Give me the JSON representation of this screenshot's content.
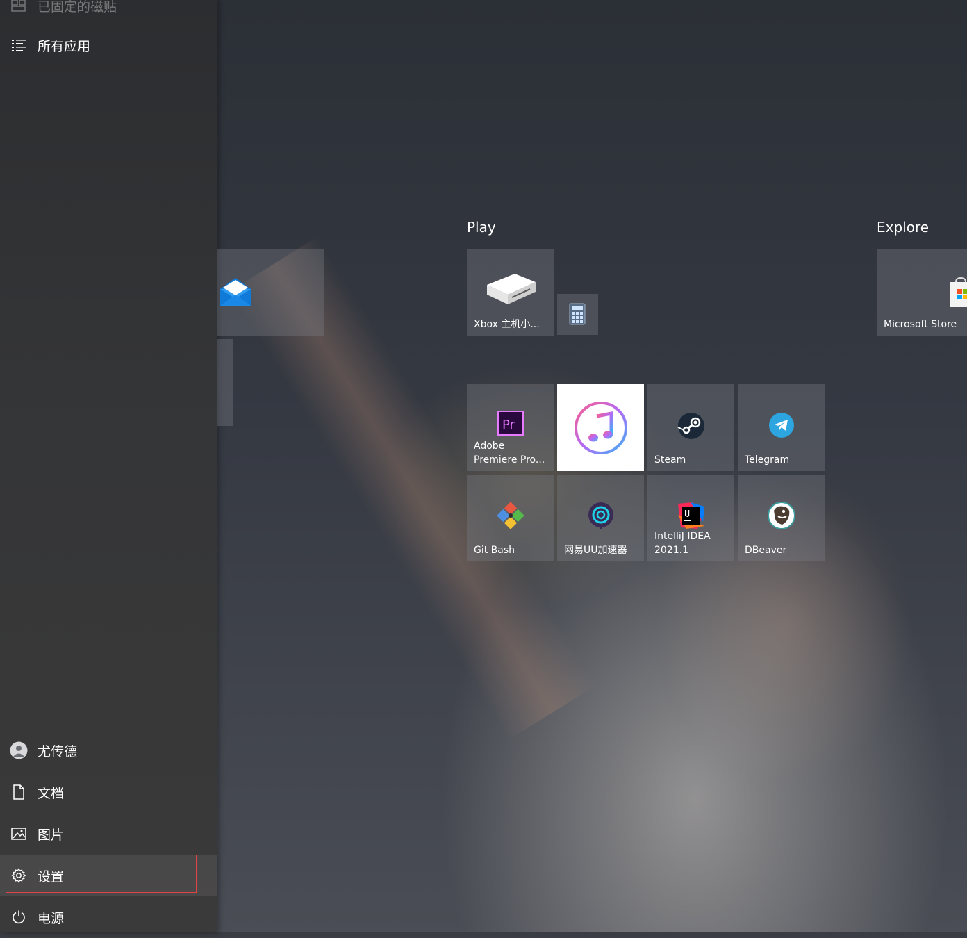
{
  "sidebar": {
    "pinned_label": "已固定的磁贴",
    "all_apps_label": "所有应用",
    "user_label": "尤传德",
    "documents_label": "文档",
    "pictures_label": "图片",
    "settings_label": "设置",
    "power_label": "电源"
  },
  "groups": {
    "play_title": "Play",
    "explore_title": "Explore"
  },
  "tiles": {
    "xbox": "Xbox 主机小...",
    "store": "Microsoft Store",
    "premiere": "Adobe\nPremiere Pro...",
    "steam": "Steam",
    "telegram": "Telegram",
    "gitbash": "Git Bash",
    "uu": "网易UU加速器",
    "intellij": "IntelliJ IDEA\n2021.1",
    "dbeaver": "DBeaver"
  },
  "icons": {
    "xbox": "xbox-console-icon",
    "calculator": "calculator-icon",
    "mail": "mail-icon",
    "store": "store-bag-icon",
    "premiere": "premiere-icon",
    "itunes": "itunes-icon",
    "steam": "steam-icon",
    "telegram": "telegram-icon",
    "gitbash": "git-icon",
    "uu": "uu-accelerator-icon",
    "intellij": "intellij-icon",
    "dbeaver": "dbeaver-icon"
  },
  "colors": {
    "focus_border": "#e04444",
    "mail_blue": "#0f7ad8",
    "premiere_purple": "#2a0a3e",
    "telegram_blue": "#2ca5e0"
  }
}
